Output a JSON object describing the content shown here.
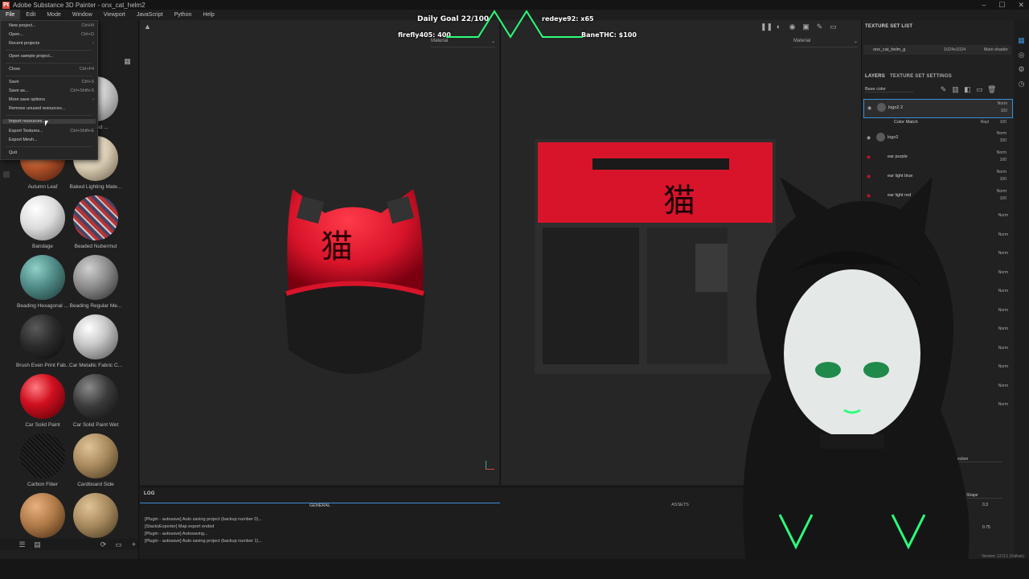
{
  "window": {
    "title": "Adobe Substance 3D Painter - onx_cat_helm2",
    "app_icon_text": "Pt"
  },
  "menu": [
    "File",
    "Edit",
    "Mode",
    "Window",
    "Viewport",
    "JavaScript",
    "Python",
    "Help"
  ],
  "file_menu": [
    {
      "label": "New project...",
      "shortcut": "Ctrl+N"
    },
    {
      "label": "Open...",
      "shortcut": "Ctrl+O"
    },
    {
      "label": "Recent projects",
      "shortcut": "›"
    },
    {
      "label": "Open sample project...",
      "shortcut": ""
    },
    {
      "label": "Close",
      "shortcut": "Ctrl+F4"
    },
    {
      "label": "Save",
      "shortcut": "Ctrl+S"
    },
    {
      "label": "Save as...",
      "shortcut": "Ctrl+Shift+S"
    },
    {
      "label": "More save options",
      "shortcut": "›"
    },
    {
      "label": "Remove unused resources...",
      "shortcut": ""
    },
    {
      "label": "Import resources...",
      "shortcut": ""
    },
    {
      "label": "Export Textures...",
      "shortcut": "Ctrl+Shift+E"
    },
    {
      "label": "Export Mesh...",
      "shortcut": ""
    },
    {
      "label": "Quit",
      "shortcut": ""
    }
  ],
  "shelf": {
    "materials": [
      {
        "name": "Brushed ...",
        "color": "#cfcfcf"
      },
      {
        "name": "Autumn Leaf",
        "color": "#b2522a"
      },
      {
        "name": "Baked Lighting Mate...",
        "color": "#d8cbb2"
      },
      {
        "name": "Bandage",
        "color": "#e0e0e0"
      },
      {
        "name": "Beaded Nubermut",
        "color": "#6a5a8a"
      },
      {
        "name": "Beading Hexagonal ...",
        "color": "#4f8a86"
      },
      {
        "name": "Beading Regular Me...",
        "color": "#8a8a8a"
      },
      {
        "name": "Brush Even Print Fab...",
        "color": "#2a2a2a"
      },
      {
        "name": "Car Metallic Fabric C...",
        "color": "#c8c8c8"
      },
      {
        "name": "Car Solid Paint",
        "color": "#d01020"
      },
      {
        "name": "Car Solid Paint Wet",
        "color": "#3a3a3a"
      },
      {
        "name": "Carbon Fiber",
        "color": "#1a1a1a"
      },
      {
        "name": "Cardboard Side",
        "color": "#a88a5e"
      },
      {
        "name": "",
        "color": "#b07a48"
      },
      {
        "name": "",
        "color": "#a88a5e"
      }
    ]
  },
  "viewport": {
    "material_3d": "Material",
    "material_2d": "Material"
  },
  "overlay": {
    "daily_goal": "Daily Goal 22/100",
    "user1": "firefly405: 400",
    "user2": "redeye92: x65",
    "user3": "BaneTHC: $100"
  },
  "texture_set_list": {
    "title": "TEXTURE SET LIST",
    "set_name": "onx_cat_helm_g",
    "resolution": "1024x1024",
    "shader": "Main shader"
  },
  "layers": {
    "tab_layers": "LAYERS",
    "tab_settings": "TEXTURE SET SETTINGS",
    "channel": "Base color",
    "items": [
      {
        "name": "logo2 2",
        "mode": "Norm",
        "opacity": "100"
      },
      {
        "name": "Color Match",
        "mode": "Repl",
        "opacity": "100"
      },
      {
        "name": "logo2",
        "mode": "Norm",
        "opacity": "100"
      },
      {
        "name": "ear purple",
        "mode": "Norm",
        "opacity": "100"
      },
      {
        "name": "ear light blue",
        "mode": "Norm",
        "opacity": "100"
      },
      {
        "name": "ear light red",
        "mode": "Norm",
        "opacity": "100"
      }
    ],
    "extra_rows": [
      "Norm",
      "Norm",
      "Norm",
      "Norm",
      "Norm",
      "Norm",
      "Norm",
      "Norm",
      "Norm",
      "Norm",
      "Norm"
    ]
  },
  "properties": {
    "projection_label": "Projection",
    "shape_label": "Shape",
    "val1": "0.3",
    "val2": "0.75"
  },
  "log": {
    "title": "LOG",
    "tab_general": "GENERAL",
    "tab_assets": "ASSETS",
    "lines": [
      "[Plugin - autosave] Auto saving project (backup number 0)...",
      "[StacksExporter] Map export ended",
      "[Plugin - autosave] Autosaving...",
      "[Plugin - autosave] Auto saving project (backup number 1)..."
    ]
  },
  "status": {
    "version": "Version: 12.0.1 (Vulkan)"
  },
  "colors": {
    "accent": "#3a8fd8",
    "helmet_red": "#d8142a",
    "neon_green": "#2bff7a"
  }
}
